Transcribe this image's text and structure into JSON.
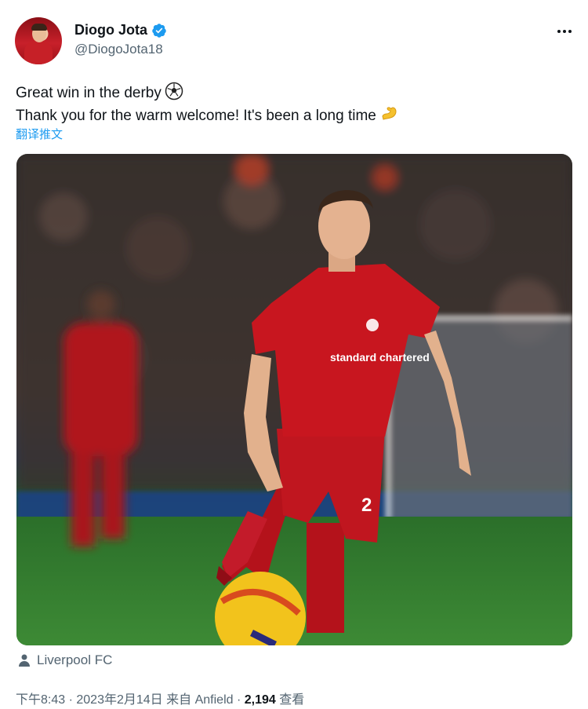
{
  "author": {
    "display_name": "Diogo Jota",
    "handle": "@DiogoJota18",
    "verified": true
  },
  "tweet": {
    "line1": "Great win in the derby",
    "line2": "Thank you for the warm welcome! It's been a long time",
    "translate_label": "翻译推文"
  },
  "photo": {
    "shirt_sponsor": "standard chartered",
    "shirt_number": "2"
  },
  "location": {
    "label": "Liverpool FC"
  },
  "meta": {
    "time": "下午8:43",
    "date": "2023年2月14日",
    "source_prefix": "来自",
    "source": "Anfield",
    "views_count": "2,194",
    "views_label": "查看"
  },
  "colors": {
    "accent": "#1d9bf0",
    "text": "#0f1419",
    "muted": "#536471",
    "kit_red": "#c0161f"
  },
  "icons": [
    "verified-badge-icon",
    "more-options-icon",
    "soccer-ball-emoji",
    "flexed-biceps-emoji",
    "person-icon"
  ]
}
